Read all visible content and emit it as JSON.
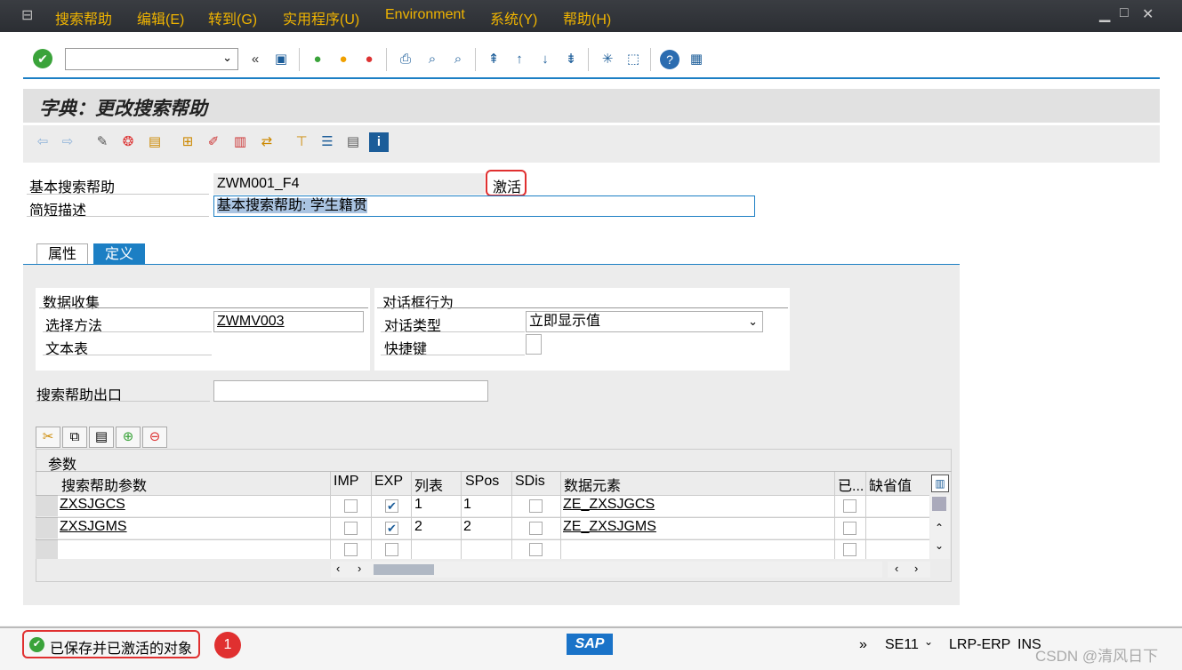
{
  "menu": {
    "items": [
      "搜索帮助",
      "编辑(E)",
      "转到(G)",
      "实用程序(U)",
      "Environment",
      "系统(Y)",
      "帮助(H)"
    ]
  },
  "page": {
    "title": "字典：更改搜索帮助"
  },
  "header_fields": {
    "basic_help_label": "基本搜索帮助",
    "basic_help_value": "ZWM001_F4",
    "status_badge": "激活",
    "short_desc_label": "简短描述",
    "short_desc_value": "基本搜索帮助: 学生籍贯"
  },
  "tabs": [
    "属性",
    "定义"
  ],
  "data_collection": {
    "title": "数据收集",
    "method_label": "选择方法",
    "method_value": "ZWMV003",
    "text_table_label": "文本表"
  },
  "dialog_behavior": {
    "title": "对话框行为",
    "dialog_type_label": "对话类型",
    "dialog_type_value": "立即显示值",
    "hotkey_label": "快捷键"
  },
  "exit": {
    "label": "搜索帮助出口"
  },
  "params": {
    "title": "参数",
    "headers": [
      "搜索帮助参数",
      "IMP",
      "EXP",
      "列表",
      "SPos",
      "SDis",
      "数据元素",
      "已...",
      "缺省值"
    ],
    "rows": [
      {
        "param": "ZXSJGCS",
        "exp": true,
        "list": "1",
        "spos": "1",
        "element": "ZE_ZXSJGCS"
      },
      {
        "param": "ZXSJGMS",
        "exp": true,
        "list": "2",
        "spos": "2",
        "element": "ZE_ZXSJGMS"
      }
    ]
  },
  "status": {
    "message": "已保存并已激活的对象",
    "annotation": "1",
    "tcode": "SE11",
    "system": "LRP-ERP",
    "mode": "INS",
    "watermark": "CSDN @清风日下"
  }
}
